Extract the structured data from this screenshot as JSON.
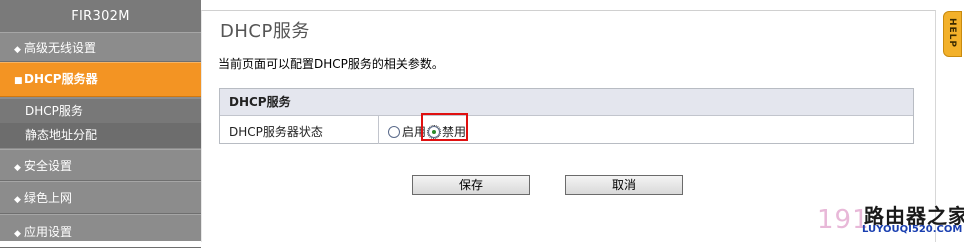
{
  "sidebar": {
    "device_name": "FIR302M",
    "items": [
      {
        "label": "高级无线设置",
        "bullet": "◆"
      },
      {
        "label": "DHCP服务器",
        "bullet": "■"
      },
      {
        "label": "安全设置",
        "bullet": "◆"
      },
      {
        "label": "绿色上网",
        "bullet": "◆"
      },
      {
        "label": "应用设置",
        "bullet": "◆"
      }
    ],
    "subitems": [
      {
        "label": "DHCP服务"
      },
      {
        "label": "静态地址分配"
      }
    ]
  },
  "main": {
    "title": "DHCP服务",
    "description": "当前页面可以配置DHCP服务的相关参数。",
    "panel": {
      "header": "DHCP服务",
      "row_label": "DHCP服务器状态",
      "options": [
        {
          "label": "启用",
          "checked": false
        },
        {
          "label": "禁用",
          "checked": true
        }
      ]
    },
    "buttons": {
      "save": "保存",
      "cancel": "取消"
    },
    "help_tab": "HELP"
  },
  "watermark": {
    "number": "191",
    "logo": "路由器之家",
    "url": "LUYOUQI520.COM"
  },
  "colors": {
    "sidebar_bg": "#8c8c8c",
    "active_item": "#f39423",
    "help_tab": "#f3b12a",
    "highlight": "#e01010"
  }
}
